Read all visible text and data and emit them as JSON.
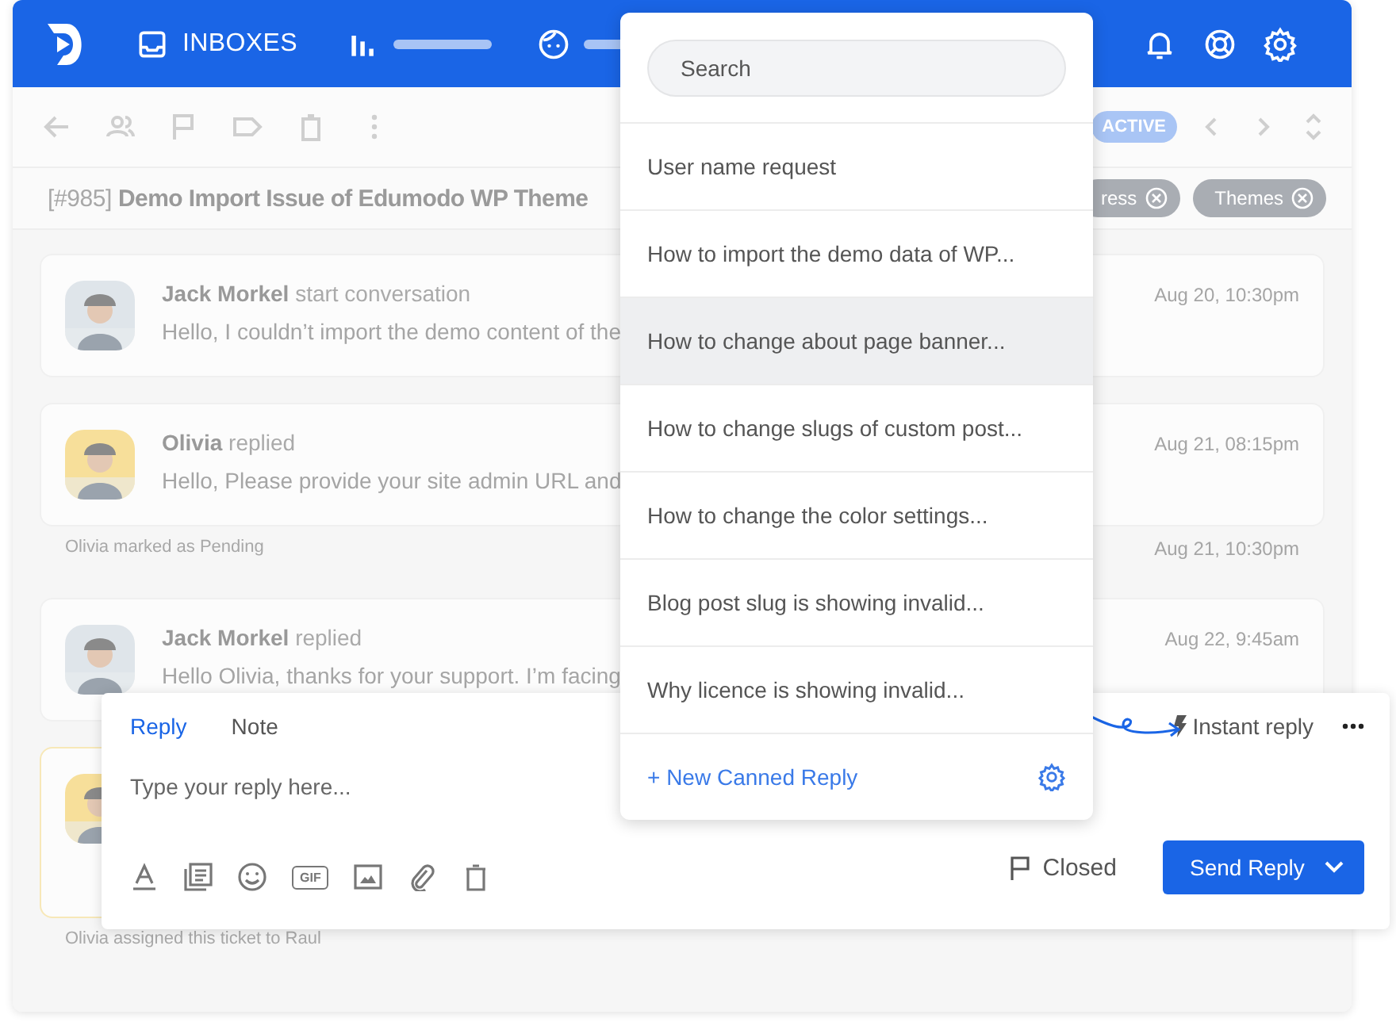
{
  "header": {
    "inbox_label": "INBOXES"
  },
  "toolbar": {
    "status": "ACTIVE"
  },
  "ticket": {
    "number": "[#985]",
    "title": "Demo Import Issue of Edumodo WP Theme",
    "tags": [
      "ress",
      "Themes"
    ]
  },
  "thread": [
    {
      "kind": "message",
      "author": "Jack Morkel",
      "action": "start conversation",
      "text": "Hello, I couldn’t import the demo content of the",
      "time": "Aug 20, 10:30pm",
      "color": "#dfe5ea",
      "highlighted": false
    },
    {
      "kind": "message",
      "author": "Olivia",
      "action": "replied",
      "text": "Hello, Please provide your site admin URL and",
      "time": "Aug 21, 08:15pm",
      "color": "#f7df9a",
      "highlighted": false
    },
    {
      "kind": "event",
      "text": "Olivia marked as Pending",
      "time": "Aug 21, 10:30pm"
    },
    {
      "kind": "message",
      "author": "Jack Morkel",
      "action": "replied",
      "text": "Hello Olivia, thanks for your support. I’m facing",
      "time": "Aug 22, 9:45am",
      "color": "#dfe5ea",
      "highlighted": false
    },
    {
      "kind": "message",
      "color": "#f7df9a",
      "highlighted": true
    },
    {
      "kind": "event",
      "text": "Olivia assigned this ticket to Raul"
    }
  ],
  "canned_replies": {
    "search": {
      "placeholder": "Search"
    },
    "items": [
      {
        "label": "User name request",
        "selected": false
      },
      {
        "label": "How to import the demo data of WP...",
        "selected": false
      },
      {
        "label": "How to change about page banner...",
        "selected": true
      },
      {
        "label": "How to change slugs of custom post...",
        "selected": false
      },
      {
        "label": "How to change the color settings...",
        "selected": false
      },
      {
        "label": "Blog post slug is showing invalid...",
        "selected": false
      },
      {
        "label": "Why licence is showing invalid...",
        "selected": false
      }
    ],
    "new_label": "+ New Canned Reply"
  },
  "composer": {
    "tabs": [
      {
        "label": "Reply",
        "selected": true
      },
      {
        "label": "Note",
        "selected": false
      }
    ],
    "placeholder": "Type your reply here...",
    "instant_label": "Instant reply",
    "gif_label": "GIF",
    "status_label": "Closed",
    "send_label": "Send Reply"
  }
}
